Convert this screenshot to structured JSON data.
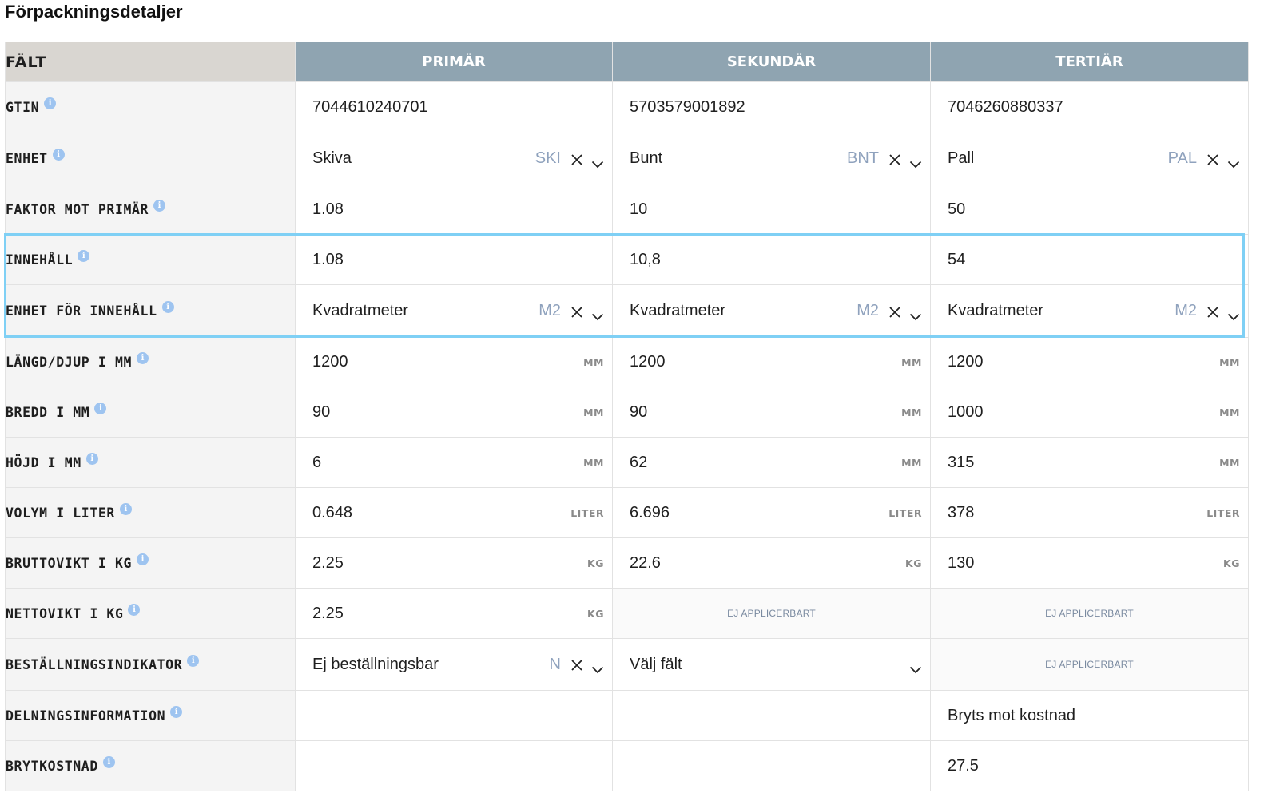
{
  "title": "Förpackningsdetaljer",
  "headers": {
    "field": "FÄLT",
    "primary": "PRIMÄR",
    "secondary": "SEKUNDÄR",
    "tertiary": "TERTIÄR"
  },
  "na_text": "EJ APPLICERBART",
  "colors": {
    "header_col": "#8fa4b1",
    "header_field": "#d9d6d1",
    "highlight": "#7fd0f5",
    "info": "#9ec4f0"
  },
  "rows": [
    {
      "label": "GTIN",
      "cells": [
        {
          "type": "text",
          "value": "7044610240701"
        },
        {
          "type": "text",
          "value": "5703579001892"
        },
        {
          "type": "text",
          "value": "7046260880337"
        }
      ]
    },
    {
      "label": "ENHET",
      "cells": [
        {
          "type": "select",
          "value": "Skiva",
          "code": "SKI"
        },
        {
          "type": "select",
          "value": "Bunt",
          "code": "BNT"
        },
        {
          "type": "select",
          "value": "Pall",
          "code": "PAL"
        }
      ]
    },
    {
      "label": "FAKTOR MOT PRIMÄR",
      "cells": [
        {
          "type": "text",
          "value": "1.08"
        },
        {
          "type": "text",
          "value": "10"
        },
        {
          "type": "text",
          "value": "50"
        }
      ]
    },
    {
      "label": "INNEHÅLL",
      "cells": [
        {
          "type": "text",
          "value": "1.08"
        },
        {
          "type": "text",
          "value": "10,8"
        },
        {
          "type": "text",
          "value": "54"
        }
      ]
    },
    {
      "label": "ENHET FÖR INNEHÅLL",
      "cells": [
        {
          "type": "select",
          "value": "Kvadratmeter",
          "code": "M2"
        },
        {
          "type": "select",
          "value": "Kvadratmeter",
          "code": "M2"
        },
        {
          "type": "select",
          "value": "Kvadratmeter",
          "code": "M2"
        }
      ]
    },
    {
      "label": "LÄNGD/DJUP I MM",
      "cells": [
        {
          "type": "unit",
          "value": "1200",
          "unit": "MM"
        },
        {
          "type": "unit",
          "value": "1200",
          "unit": "MM"
        },
        {
          "type": "unit",
          "value": "1200",
          "unit": "MM"
        }
      ]
    },
    {
      "label": "BREDD I MM",
      "cells": [
        {
          "type": "unit",
          "value": "90",
          "unit": "MM"
        },
        {
          "type": "unit",
          "value": "90",
          "unit": "MM"
        },
        {
          "type": "unit",
          "value": "1000",
          "unit": "MM"
        }
      ]
    },
    {
      "label": "HÖJD I MM",
      "cells": [
        {
          "type": "unit",
          "value": "6",
          "unit": "MM"
        },
        {
          "type": "unit",
          "value": "62",
          "unit": "MM"
        },
        {
          "type": "unit",
          "value": "315",
          "unit": "MM"
        }
      ]
    },
    {
      "label": "VOLYM I LITER",
      "cells": [
        {
          "type": "unit",
          "value": "0.648",
          "unit": "LITER"
        },
        {
          "type": "unit",
          "value": "6.696",
          "unit": "LITER"
        },
        {
          "type": "unit",
          "value": "378",
          "unit": "LITER"
        }
      ]
    },
    {
      "label": "BRUTTOVIKT I KG",
      "cells": [
        {
          "type": "unit",
          "value": "2.25",
          "unit": "KG"
        },
        {
          "type": "unit",
          "value": "22.6",
          "unit": "KG"
        },
        {
          "type": "unit",
          "value": "130",
          "unit": "KG"
        }
      ]
    },
    {
      "label": "NETTOVIKT I KG",
      "cells": [
        {
          "type": "unit",
          "value": "2.25",
          "unit": "KG"
        },
        {
          "type": "na"
        },
        {
          "type": "na"
        }
      ]
    },
    {
      "label": "BESTÄLLNINGSINDIKATOR",
      "cells": [
        {
          "type": "select",
          "value": "Ej beställningsbar",
          "code": "N"
        },
        {
          "type": "select-empty",
          "value": "Välj fält"
        },
        {
          "type": "na"
        }
      ]
    },
    {
      "label": "DELNINGSINFORMATION",
      "cells": [
        {
          "type": "empty"
        },
        {
          "type": "empty"
        },
        {
          "type": "text",
          "value": "Bryts mot kostnad"
        }
      ]
    },
    {
      "label": "BRYTKOSTNAD",
      "cells": [
        {
          "type": "empty"
        },
        {
          "type": "empty"
        },
        {
          "type": "text",
          "value": "27.5"
        }
      ]
    }
  ]
}
